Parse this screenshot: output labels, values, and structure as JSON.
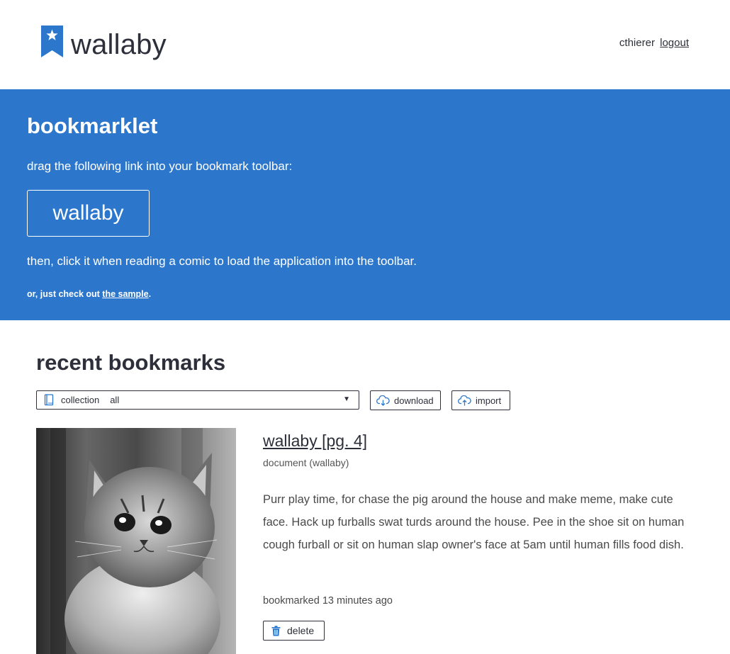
{
  "header": {
    "app_name": "wallaby",
    "username": "cthierer",
    "logout_label": "logout"
  },
  "banner": {
    "title": "bookmarklet",
    "drag_instruction": "drag the following link into your bookmark toolbar:",
    "bookmarklet_label": "wallaby",
    "then_instruction": "then, click it when reading a comic to load the application into the toolbar.",
    "or_prefix": "or, just check out ",
    "sample_link": "the sample",
    "or_suffix": "."
  },
  "recent": {
    "title": "recent bookmarks",
    "collection_label": "collection",
    "collection_value": "all",
    "download_label": "download",
    "import_label": "import"
  },
  "bookmarks": [
    {
      "title": "wallaby [pg. 4]",
      "type": "document (wallaby)",
      "description": "Purr play time, for chase the pig around the house and make meme, make cute face. Hack up furballs swat turds around the house. Pee in the shoe sit on human cough furball or sit on human slap owner's face at 5am until human fills food dish.",
      "bookmarked": "bookmarked 13 minutes ago",
      "delete_label": "delete"
    }
  ],
  "colors": {
    "brand_blue": "#2c77cc",
    "text_dark": "#2d2f3a",
    "background": "#ffffff"
  },
  "icons": {
    "logo": "bookmark-star-icon",
    "collection": "book-icon",
    "download": "cloud-download-icon",
    "import": "cloud-upload-icon",
    "delete": "trash-icon"
  }
}
